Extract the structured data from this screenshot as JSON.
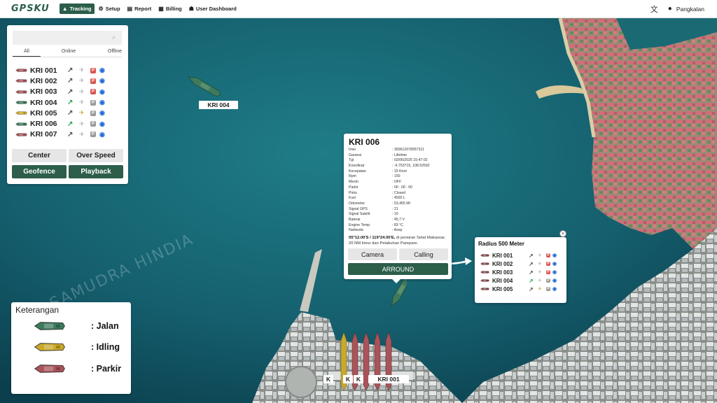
{
  "app": {
    "logo": "GPSKU"
  },
  "nav": [
    {
      "label": "Tracking",
      "icon": "navigation-arrow-icon",
      "active": true
    },
    {
      "label": "Setup",
      "icon": "gear-icon",
      "active": false
    },
    {
      "label": "Report",
      "icon": "document-icon",
      "active": false
    },
    {
      "label": "Billing",
      "icon": "billing-icon",
      "active": false
    },
    {
      "label": "User Dashboard",
      "icon": "users-icon",
      "active": false
    }
  ],
  "header": {
    "user": "Pangkalan"
  },
  "search": {
    "placeholder": ""
  },
  "filters": [
    "All",
    "Online",
    "Offline"
  ],
  "colors": {
    "jalan": "#3e7a5c",
    "idling": "#c9a92a",
    "parkir": "#a9545a",
    "accent": "#2c5e4a",
    "trend_green": "#2aa64c",
    "trend_gray": "#555555",
    "wifi": "#1e6bd6"
  },
  "vessels": [
    {
      "name": "KRI 001",
      "status": "parkir",
      "trend": "gray",
      "plane": "gray",
      "badge": "parkir"
    },
    {
      "name": "KRI 002",
      "status": "parkir",
      "trend": "gray",
      "plane": "gray",
      "badge": "parkir"
    },
    {
      "name": "KRI 003",
      "status": "parkir",
      "trend": "gray",
      "plane": "gray",
      "badge": "parkir"
    },
    {
      "name": "KRI 004",
      "status": "jalan",
      "trend": "green",
      "plane": "gray",
      "badge": "gray"
    },
    {
      "name": "KRI 005",
      "status": "idling",
      "trend": "gray",
      "plane": "yellow",
      "badge": "gray"
    },
    {
      "name": "KRI 006",
      "status": "jalan",
      "trend": "green",
      "plane": "gray",
      "badge": "gray"
    },
    {
      "name": "KRI 007",
      "status": "parkir",
      "trend": "gray",
      "plane": "gray",
      "badge": "gray"
    }
  ],
  "buttons": {
    "center": "Center",
    "overspeed": "Over Speed",
    "geofence": "Geofence",
    "playback": "Playback"
  },
  "map": {
    "watermark": "SAMUDRA HINDIA",
    "labels": {
      "kri004": "KRI 004",
      "kri001": "KRI 001",
      "k1": "K",
      "k2": "K",
      "k3": "K"
    }
  },
  "detail": {
    "title": "KRI 006",
    "fields": [
      {
        "k": "Imei",
        "v": ": 350612078957311"
      },
      {
        "k": "Garansi",
        "v": ": Lifetime"
      },
      {
        "k": "Tgl",
        "v": ": 02/06/2025 15:47:02"
      },
      {
        "k": "Koordinat",
        "v": ": -6.753715, 108.52592"
      },
      {
        "k": "Kecepatan",
        "v": ": 15 Knot"
      },
      {
        "k": "Rpm",
        "v": ": 150"
      },
      {
        "k": "Mesin",
        "v": ": OFF"
      },
      {
        "k": "Parkir",
        "v": ": 00 : 00 : 00"
      },
      {
        "k": "Pintu",
        "v": ": Closed"
      },
      {
        "k": "Fuel",
        "v": ": 4500 L"
      },
      {
        "k": "Odometer",
        "v": ": 53,455 MI"
      },
      {
        "k": "Signal GPS",
        "v": ": 21"
      },
      {
        "k": "Signal Satelit",
        "v": ": 10"
      },
      {
        "k": "Baterai",
        "v": ": 45,7 V"
      },
      {
        "k": "Engine Temp",
        "v": ": 83 °C"
      },
      {
        "k": "Nahkoda",
        "v": ": Asep"
      }
    ],
    "location_bold": "05°12.00'S / 119°24.00'E,",
    "location_text": " di perairan Selat Makassar, 20 NM timur dan Pelabuhan Parepare.",
    "camera": "Camera",
    "calling": "Calling",
    "around": "ARROUND"
  },
  "radius": {
    "title": "Radius 500 Meter",
    "close": "×",
    "vessels": [
      {
        "name": "KRI 001",
        "trend": "gray",
        "plane": "gray",
        "badge": "parkir"
      },
      {
        "name": "KRI 002",
        "trend": "gray",
        "plane": "gray",
        "badge": "parkir"
      },
      {
        "name": "KRI 003",
        "trend": "gray",
        "plane": "gray",
        "badge": "parkir"
      },
      {
        "name": "KRI 004",
        "trend": "green",
        "plane": "gray",
        "badge": "gray"
      },
      {
        "name": "KRI 005",
        "trend": "gray",
        "plane": "yellow",
        "badge": "gray"
      }
    ]
  },
  "legend": {
    "title": "Keterangan",
    "items": [
      {
        "label": ": Jalan",
        "status": "jalan"
      },
      {
        "label": ": Idling",
        "status": "idling"
      },
      {
        "label": ": Parkir",
        "status": "parkir"
      }
    ]
  }
}
